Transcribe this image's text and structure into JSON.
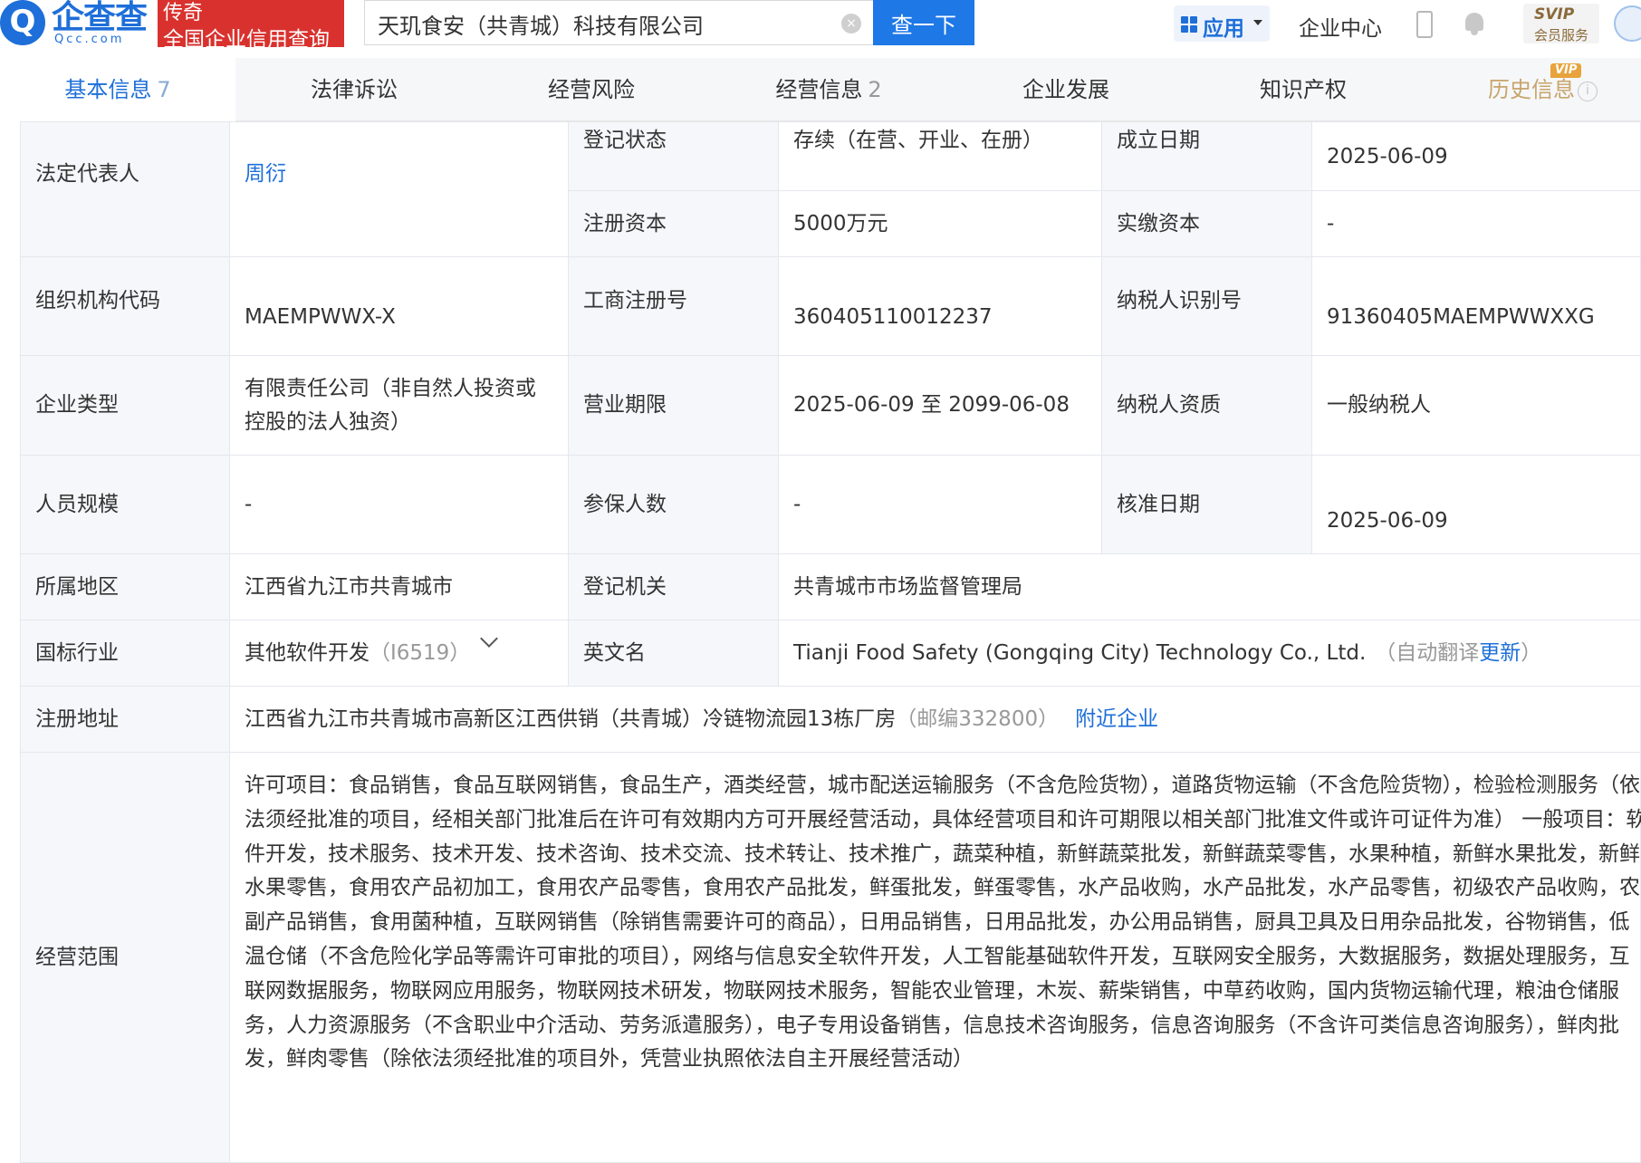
{
  "header": {
    "logo_symbol": "Q",
    "logo_cn": "企查查",
    "logo_en": "Qcc.com",
    "logo_badge_line1": "传奇",
    "logo_badge_line2": "全国企业信用查询",
    "search_value": "天玑食安（共青城）科技有限公司",
    "clear_symbol": "×",
    "search_button": "查一下",
    "apps_label": "应用",
    "enterprise_center": "企业中心",
    "svip_title": "SVIP",
    "svip_sub": "会员服务"
  },
  "tabs": [
    {
      "label": "基本信息",
      "count": "7"
    },
    {
      "label": "法律诉讼",
      "count": ""
    },
    {
      "label": "经营风险",
      "count": ""
    },
    {
      "label": "经营信息",
      "count": "2"
    },
    {
      "label": "企业发展",
      "count": ""
    },
    {
      "label": "知识产权",
      "count": ""
    },
    {
      "label": "历史信息",
      "count": ""
    }
  ],
  "vip_tag": "VIP",
  "help_symbol": "i",
  "info": {
    "legal_rep_label": "法定代表人",
    "legal_rep_value": "周衍",
    "reg_status_label": "登记状态",
    "reg_status_value": "存续（在营、开业、在册）",
    "found_date_label": "成立日期",
    "found_date_value": "2025-06-09",
    "reg_capital_label": "注册资本",
    "reg_capital_value": "5000万元",
    "paid_capital_label": "实缴资本",
    "paid_capital_value": "-",
    "org_code_label": "组织机构代码",
    "org_code_value": "MAEMPWWX-X",
    "biz_reg_no_label": "工商注册号",
    "biz_reg_no_value": "360405110012237",
    "taxpayer_id_label": "纳税人识别号",
    "taxpayer_id_value": "91360405MAEMPWWXXG",
    "ent_type_label": "企业类型",
    "ent_type_value_line1": "有限责任公司（非自然人投资或",
    "ent_type_value_line2": "控股的法人独资）",
    "biz_term_label": "营业期限",
    "biz_term_value": "2025-06-09 至 2099-06-08",
    "taxpayer_qual_label": "纳税人资质",
    "taxpayer_qual_value": "一般纳税人",
    "staff_size_label": "人员规模",
    "staff_size_value": "-",
    "insured_label": "参保人数",
    "insured_value": "-",
    "approve_date_label": "核准日期",
    "approve_date_value": "2025-06-09",
    "region_label": "所属地区",
    "region_value": "江西省九江市共青城市",
    "reg_authority_label": "登记机关",
    "reg_authority_value": "共青城市市场监督管理局",
    "industry_label": "国标行业",
    "industry_value": "其他软件开发",
    "industry_code": "（I6519）",
    "english_name_label": "英文名",
    "english_name_value": "Tianji Food Safety (Gongqing City) Technology Co., Ltd.",
    "auto_translate_prefix": "（自动翻译",
    "update_link": "更新",
    "auto_translate_suffix": "）",
    "address_label": "注册地址",
    "address_value": "江西省九江市共青城市高新区江西供销（共青城）冷链物流园13栋厂房",
    "postcode": "（邮编332800）",
    "nearby_link": "附近企业",
    "scope_label": "经营范围",
    "scope_value": "许可项目：食品销售，食品互联网销售，食品生产，酒类经营，城市配送运输服务（不含危险货物），道路货物运输（不含危险货物），检验检测服务（依法须经批准的项目，经相关部门批准后在许可有效期内方可开展经营活动，具体经营项目和许可期限以相关部门批准文件或许可证件为准） 一般项目：软件开发，技术服务、技术开发、技术咨询、技术交流、技术转让、技术推广，蔬菜种植，新鲜蔬菜批发，新鲜蔬菜零售，水果种植，新鲜水果批发，新鲜水果零售，食用农产品初加工，食用农产品零售，食用农产品批发，鲜蛋批发，鲜蛋零售，水产品收购，水产品批发，水产品零售，初级农产品收购，农副产品销售，食用菌种植，互联网销售（除销售需要许可的商品），日用品销售，日用品批发，办公用品销售，厨具卫具及日用杂品批发，谷物销售，低温仓储（不含危险化学品等需许可审批的项目），网络与信息安全软件开发，人工智能基础软件开发，互联网安全服务，大数据服务，数据处理服务，互联网数据服务，物联网应用服务，物联网技术研发，物联网技术服务，智能农业管理，木炭、薪柴销售，中草药收购，国内货物运输代理，粮油仓储服务，人力资源服务（不含职业中介活动、劳务派遣服务），电子专用设备销售，信息技术咨询服务，信息咨询服务（不含许可类信息咨询服务），鲜肉批发，鲜肉零售（除依法须经批准的项目外，凭营业执照依法自主开展经营活动）"
  }
}
